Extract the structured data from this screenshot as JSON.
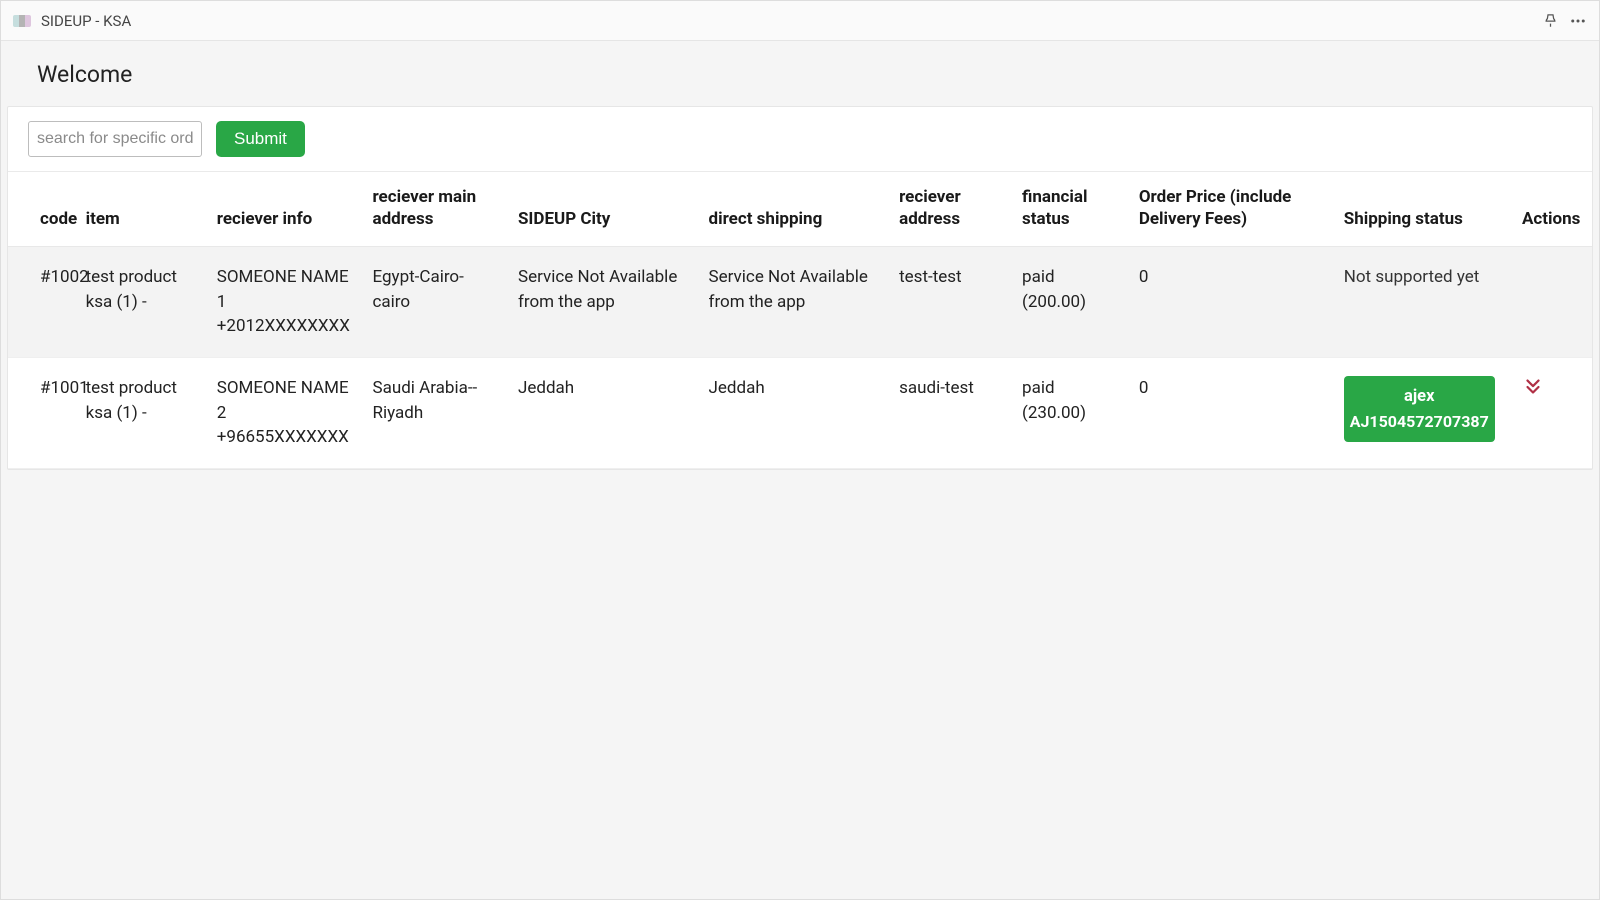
{
  "titlebar": {
    "app_name": "SIDEUP - KSA"
  },
  "header": {
    "title": "Welcome"
  },
  "toolbar": {
    "search_placeholder": "search for specific order",
    "search_value": "",
    "submit_label": "Submit"
  },
  "table": {
    "headers": {
      "code": "code",
      "item": "item",
      "reciever_info": "reciever info",
      "reciever_main_address": "reciever main address",
      "sideup_city": "SIDEUP City",
      "direct_shipping": "direct shipping",
      "reciever_address": "reciever address",
      "financial_status": "financial status",
      "order_price": "Order Price (include Delivery Fees)",
      "shipping_status": "Shipping status",
      "actions": "Actions"
    },
    "rows": [
      {
        "code": "#1002",
        "item": "test product ksa (1) -",
        "reciever_info": "SOMEONE NAME 1 +2012XXXXXXXX",
        "reciever_main_address": "Egypt-Cairo-cairo",
        "sideup_city": "Service Not Available from the app",
        "direct_shipping": "Service Not Available from the app",
        "reciever_address": "test-test",
        "financial_status": "paid (200.00)",
        "order_price": "0",
        "shipping_status_type": "text",
        "shipping_status_text": "Not supported yet",
        "actions": ""
      },
      {
        "code": "#1001",
        "item": "test product ksa (1) -",
        "reciever_info": "SOMEONE NAME 2 +96655XXXXXXX",
        "reciever_main_address": "Saudi Arabia--Riyadh",
        "sideup_city": "Jeddah",
        "direct_shipping": "Jeddah",
        "reciever_address": "saudi-test",
        "financial_status": "paid (230.00)",
        "order_price": "0",
        "shipping_status_type": "badge",
        "shipping_badge_line1": "ajex",
        "shipping_badge_line2": "AJ1504572707387",
        "actions": "expand"
      }
    ]
  }
}
